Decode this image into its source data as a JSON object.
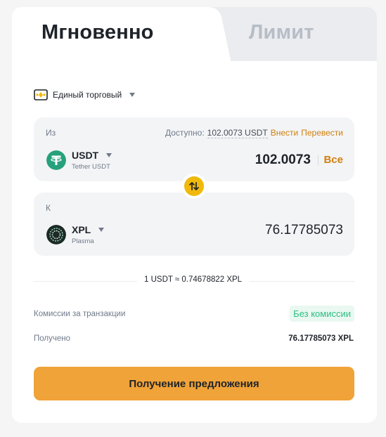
{
  "tabs": {
    "instant": "Мгновенно",
    "limit": "Лимит"
  },
  "account": {
    "name": "Единый торговый",
    "icon": "wallet-icon"
  },
  "from": {
    "label": "Из",
    "available_label": "Доступно:",
    "available_amount": "102.0073 USDT",
    "deposit_link": "Внести",
    "transfer_link": "Перевести",
    "coin": "USDT",
    "coin_full": "Tether USDT",
    "amount": "102.0073",
    "max_label": "Все"
  },
  "to": {
    "label": "К",
    "coin": "XPL",
    "coin_full": "Plasma",
    "amount": "76.17785073"
  },
  "rate": "1 USDT ≈ 0.74678822 XPL",
  "fees": {
    "label": "Комиссии за транзакции",
    "value": "Без комиссии"
  },
  "received": {
    "label": "Получено",
    "value": "76.17785073 XPL"
  },
  "cta_label": "Получение предложения",
  "colors": {
    "accent": "#f0a338",
    "link": "#d0800e",
    "swap": "#f0b90b",
    "success": "#2ebd85",
    "usdt": "#26a17b"
  }
}
